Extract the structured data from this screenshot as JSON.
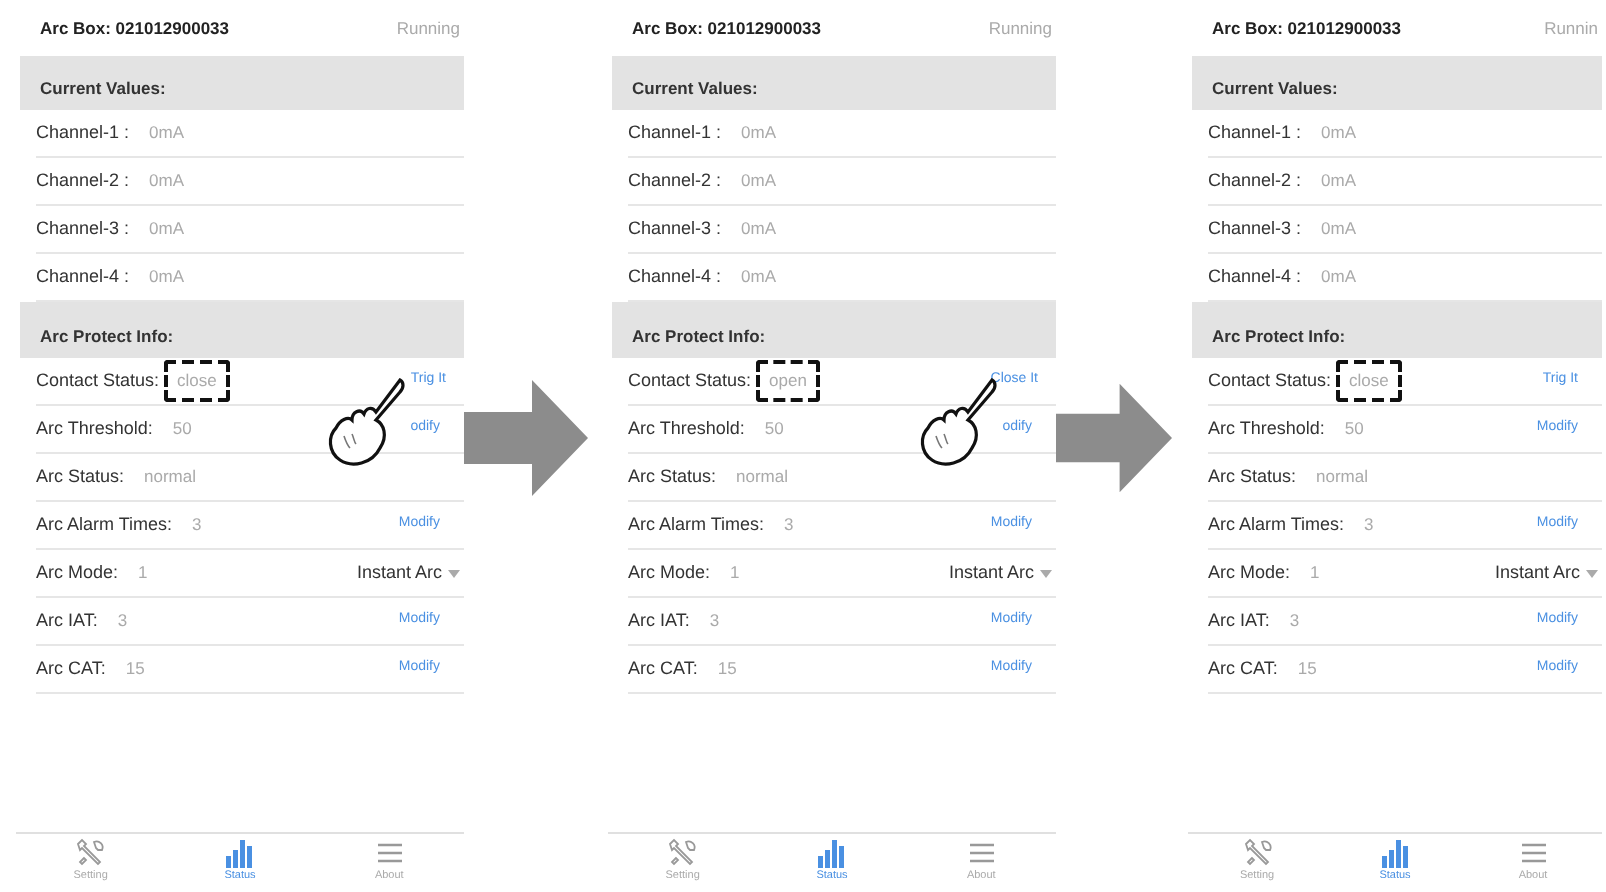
{
  "screens": [
    {
      "title": "Arc Box: 021012900033",
      "status": "Running",
      "sections": [
        {
          "heading": "Current Values:",
          "rows": [
            {
              "kind": "plain",
              "label": "Channel-1 :",
              "value": "0mA"
            },
            {
              "kind": "plain",
              "label": "Channel-2 :",
              "value": "0mA"
            },
            {
              "kind": "plain",
              "label": "Channel-3 :",
              "value": "0mA"
            },
            {
              "kind": "plain",
              "label": "Channel-4 :",
              "value": "0mA"
            }
          ]
        },
        {
          "heading": "Arc Protect Info:",
          "rows": [
            {
              "kind": "action",
              "label": "Contact Status:",
              "value": "close",
              "action": "Trig It",
              "value_highlighted": true,
              "action_highlighted": true,
              "touched": true
            },
            {
              "kind": "action",
              "label": "Arc Threshold:",
              "value": "50",
              "action": "odify",
              "value_highlighted": false,
              "action_highlighted": false,
              "touched": false
            },
            {
              "kind": "plain",
              "label": "Arc Status:",
              "value": "normal"
            },
            {
              "kind": "action",
              "label": "Arc Alarm Times:",
              "value": "3",
              "action": "Modify",
              "value_highlighted": false,
              "action_highlighted": false,
              "touched": false
            },
            {
              "kind": "dropdown",
              "label": "Arc Mode:",
              "value": "1",
              "option": "Instant Arc"
            },
            {
              "kind": "action",
              "label": "Arc IAT:",
              "value": "3",
              "action": "Modify",
              "value_highlighted": false,
              "action_highlighted": false,
              "touched": false
            },
            {
              "kind": "action",
              "label": "Arc CAT:",
              "value": "15",
              "action": "Modify",
              "value_highlighted": false,
              "action_highlighted": false,
              "touched": false
            }
          ]
        }
      ],
      "tabs": [
        {
          "label": "Setting",
          "selected": false
        },
        {
          "label": "Status",
          "selected": true
        },
        {
          "label": "About",
          "selected": false
        }
      ]
    },
    {
      "title": "Arc Box: 021012900033",
      "status": "Running",
      "sections": [
        {
          "heading": "Current Values:",
          "rows": [
            {
              "kind": "plain",
              "label": "Channel-1 :",
              "value": "0mA"
            },
            {
              "kind": "plain",
              "label": "Channel-2 :",
              "value": "0mA"
            },
            {
              "kind": "plain",
              "label": "Channel-3 :",
              "value": "0mA"
            },
            {
              "kind": "plain",
              "label": "Channel-4 :",
              "value": "0mA"
            }
          ]
        },
        {
          "heading": "Arc Protect Info:",
          "rows": [
            {
              "kind": "action",
              "label": "Contact Status:",
              "value": "open",
              "action": "Close It",
              "value_highlighted": true,
              "action_highlighted": true,
              "touched": true
            },
            {
              "kind": "action",
              "label": "Arc Threshold:",
              "value": "50",
              "action": "odify",
              "value_highlighted": false,
              "action_highlighted": false,
              "touched": false
            },
            {
              "kind": "plain",
              "label": "Arc Status:",
              "value": "normal"
            },
            {
              "kind": "action",
              "label": "Arc Alarm Times:",
              "value": "3",
              "action": "Modify",
              "value_highlighted": false,
              "action_highlighted": false,
              "touched": false
            },
            {
              "kind": "dropdown",
              "label": "Arc Mode:",
              "value": "1",
              "option": "Instant Arc"
            },
            {
              "kind": "action",
              "label": "Arc IAT:",
              "value": "3",
              "action": "Modify",
              "value_highlighted": false,
              "action_highlighted": false,
              "touched": false
            },
            {
              "kind": "action",
              "label": "Arc CAT:",
              "value": "15",
              "action": "Modify",
              "value_highlighted": false,
              "action_highlighted": false,
              "touched": false
            }
          ]
        }
      ],
      "tabs": [
        {
          "label": "Setting",
          "selected": false
        },
        {
          "label": "Status",
          "selected": true
        },
        {
          "label": "About",
          "selected": false
        }
      ]
    },
    {
      "title": "Arc Box: 021012900033",
      "status": "Runnin",
      "sections": [
        {
          "heading": "Current Values:",
          "rows": [
            {
              "kind": "plain",
              "label": "Channel-1 :",
              "value": "0mA"
            },
            {
              "kind": "plain",
              "label": "Channel-2 :",
              "value": "0mA"
            },
            {
              "kind": "plain",
              "label": "Channel-3 :",
              "value": "0mA"
            },
            {
              "kind": "plain",
              "label": "Channel-4 :",
              "value": "0mA"
            }
          ]
        },
        {
          "heading": "Arc Protect Info:",
          "rows": [
            {
              "kind": "action",
              "label": "Contact Status:",
              "value": "close",
              "action": "Trig It",
              "value_highlighted": true,
              "action_highlighted": false,
              "touched": false
            },
            {
              "kind": "action",
              "label": "Arc Threshold:",
              "value": "50",
              "action": "Modify",
              "value_highlighted": false,
              "action_highlighted": false,
              "touched": false
            },
            {
              "kind": "plain",
              "label": "Arc Status:",
              "value": "normal"
            },
            {
              "kind": "action",
              "label": "Arc Alarm Times:",
              "value": "3",
              "action": "Modify",
              "value_highlighted": false,
              "action_highlighted": false,
              "touched": false
            },
            {
              "kind": "dropdown",
              "label": "Arc Mode:",
              "value": "1",
              "option": "Instant Arc"
            },
            {
              "kind": "action",
              "label": "Arc IAT:",
              "value": "3",
              "action": "Modify",
              "value_highlighted": false,
              "action_highlighted": false,
              "touched": false
            },
            {
              "kind": "action",
              "label": "Arc CAT:",
              "value": "15",
              "action": "Modify",
              "value_highlighted": false,
              "action_highlighted": false,
              "touched": false
            }
          ]
        }
      ],
      "tabs": [
        {
          "label": "Setting",
          "selected": false
        },
        {
          "label": "Status",
          "selected": true
        },
        {
          "label": "About",
          "selected": false
        }
      ]
    }
  ]
}
